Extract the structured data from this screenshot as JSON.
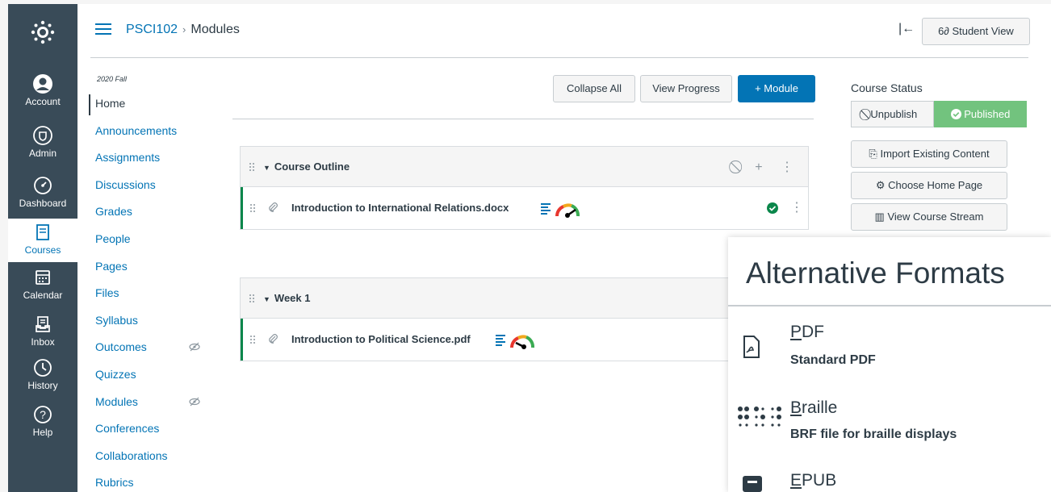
{
  "colors": {
    "nav_bg": "#394b58",
    "link": "#0374b5",
    "primary": "#0374b5",
    "published": "#72c37e",
    "item_border": "#0b874b"
  },
  "global_nav": [
    {
      "label": "Account",
      "icon": "account-icon"
    },
    {
      "label": "Admin",
      "icon": "shield-icon"
    },
    {
      "label": "Dashboard",
      "icon": "dashboard-icon"
    },
    {
      "label": "Courses",
      "icon": "book-icon"
    },
    {
      "label": "Calendar",
      "icon": "calendar-icon"
    },
    {
      "label": "Inbox",
      "icon": "inbox-icon"
    },
    {
      "label": "History",
      "icon": "clock-icon"
    },
    {
      "label": "Help",
      "icon": "help-icon"
    }
  ],
  "breadcrumb": {
    "course": "PSCI102",
    "separator": "›",
    "current": "Modules"
  },
  "header": {
    "collapse_nav": "|←",
    "student_view": "6∂ Student View"
  },
  "course_nav": {
    "term": "2020 Fall",
    "items": [
      {
        "label": "Home"
      },
      {
        "label": "Announcements"
      },
      {
        "label": "Assignments"
      },
      {
        "label": "Discussions"
      },
      {
        "label": "Grades"
      },
      {
        "label": "People"
      },
      {
        "label": "Pages"
      },
      {
        "label": "Files"
      },
      {
        "label": "Syllabus"
      },
      {
        "label": "Outcomes"
      },
      {
        "label": "Quizzes"
      },
      {
        "label": "Modules"
      },
      {
        "label": "Conferences"
      },
      {
        "label": "Collaborations"
      },
      {
        "label": "Rubrics"
      }
    ]
  },
  "toolbar": {
    "collapse_all": "Collapse All",
    "view_progress": "View Progress",
    "add_module": "+ Module"
  },
  "modules": [
    {
      "title": "Course Outline",
      "items": [
        {
          "title": "Introduction to International Relations.docx"
        }
      ]
    },
    {
      "title": "Week 1",
      "items": [
        {
          "title": "Introduction to Political Science.pdf"
        }
      ]
    }
  ],
  "course_status": {
    "title": "Course Status",
    "unpublish": "Unpublish",
    "published": "Published",
    "buttons": [
      "Import Existing Content",
      "Choose Home Page",
      "View Course Stream"
    ]
  },
  "alt_formats": {
    "title": "Alternative Formats",
    "formats": [
      {
        "key": "P",
        "rest": "DF",
        "desc": "Standard PDF"
      },
      {
        "key": "B",
        "rest": "raille",
        "desc": "BRF file for braille displays"
      },
      {
        "key": "E",
        "rest": "PUB",
        "desc": ""
      }
    ]
  }
}
